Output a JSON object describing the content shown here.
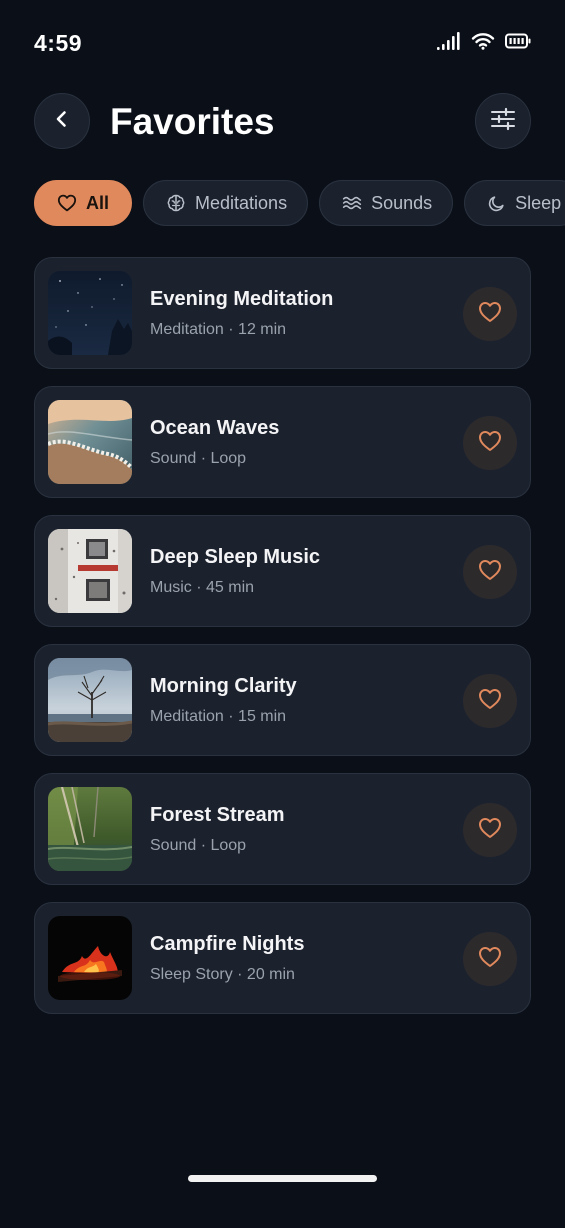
{
  "status_bar": {
    "time": "4:59"
  },
  "header": {
    "title": "Favorites",
    "back_icon": "chevron-left-icon",
    "filter_icon": "sliders-icon"
  },
  "chips": [
    {
      "label": "All",
      "icon": "heart-icon",
      "active": true
    },
    {
      "label": "Meditations",
      "icon": "brain-icon",
      "active": false
    },
    {
      "label": "Sounds",
      "icon": "waves-icon",
      "active": false
    },
    {
      "label": "Sleep",
      "icon": "moon-icon",
      "active": false
    }
  ],
  "items": [
    {
      "title": "Evening Meditation",
      "meta": "Meditation · 12 min",
      "thumb": "starry-night"
    },
    {
      "title": "Ocean Waves",
      "meta": "Sound · Loop",
      "thumb": "ocean-shore"
    },
    {
      "title": "Deep Sleep Music",
      "meta": "Music · 45 min",
      "thumb": "rainy-window"
    },
    {
      "title": "Morning Clarity",
      "meta": "Meditation · 15 min",
      "thumb": "lone-tree-lake"
    },
    {
      "title": "Forest Stream",
      "meta": "Sound · Loop",
      "thumb": "forest-water"
    },
    {
      "title": "Campfire Nights",
      "meta": "Sleep Story · 20 min",
      "thumb": "campfire"
    }
  ],
  "colors": {
    "background": "#0b0f17",
    "card": "#1b222e",
    "accent": "#e0895d",
    "muted_text": "#9aa2ae"
  }
}
